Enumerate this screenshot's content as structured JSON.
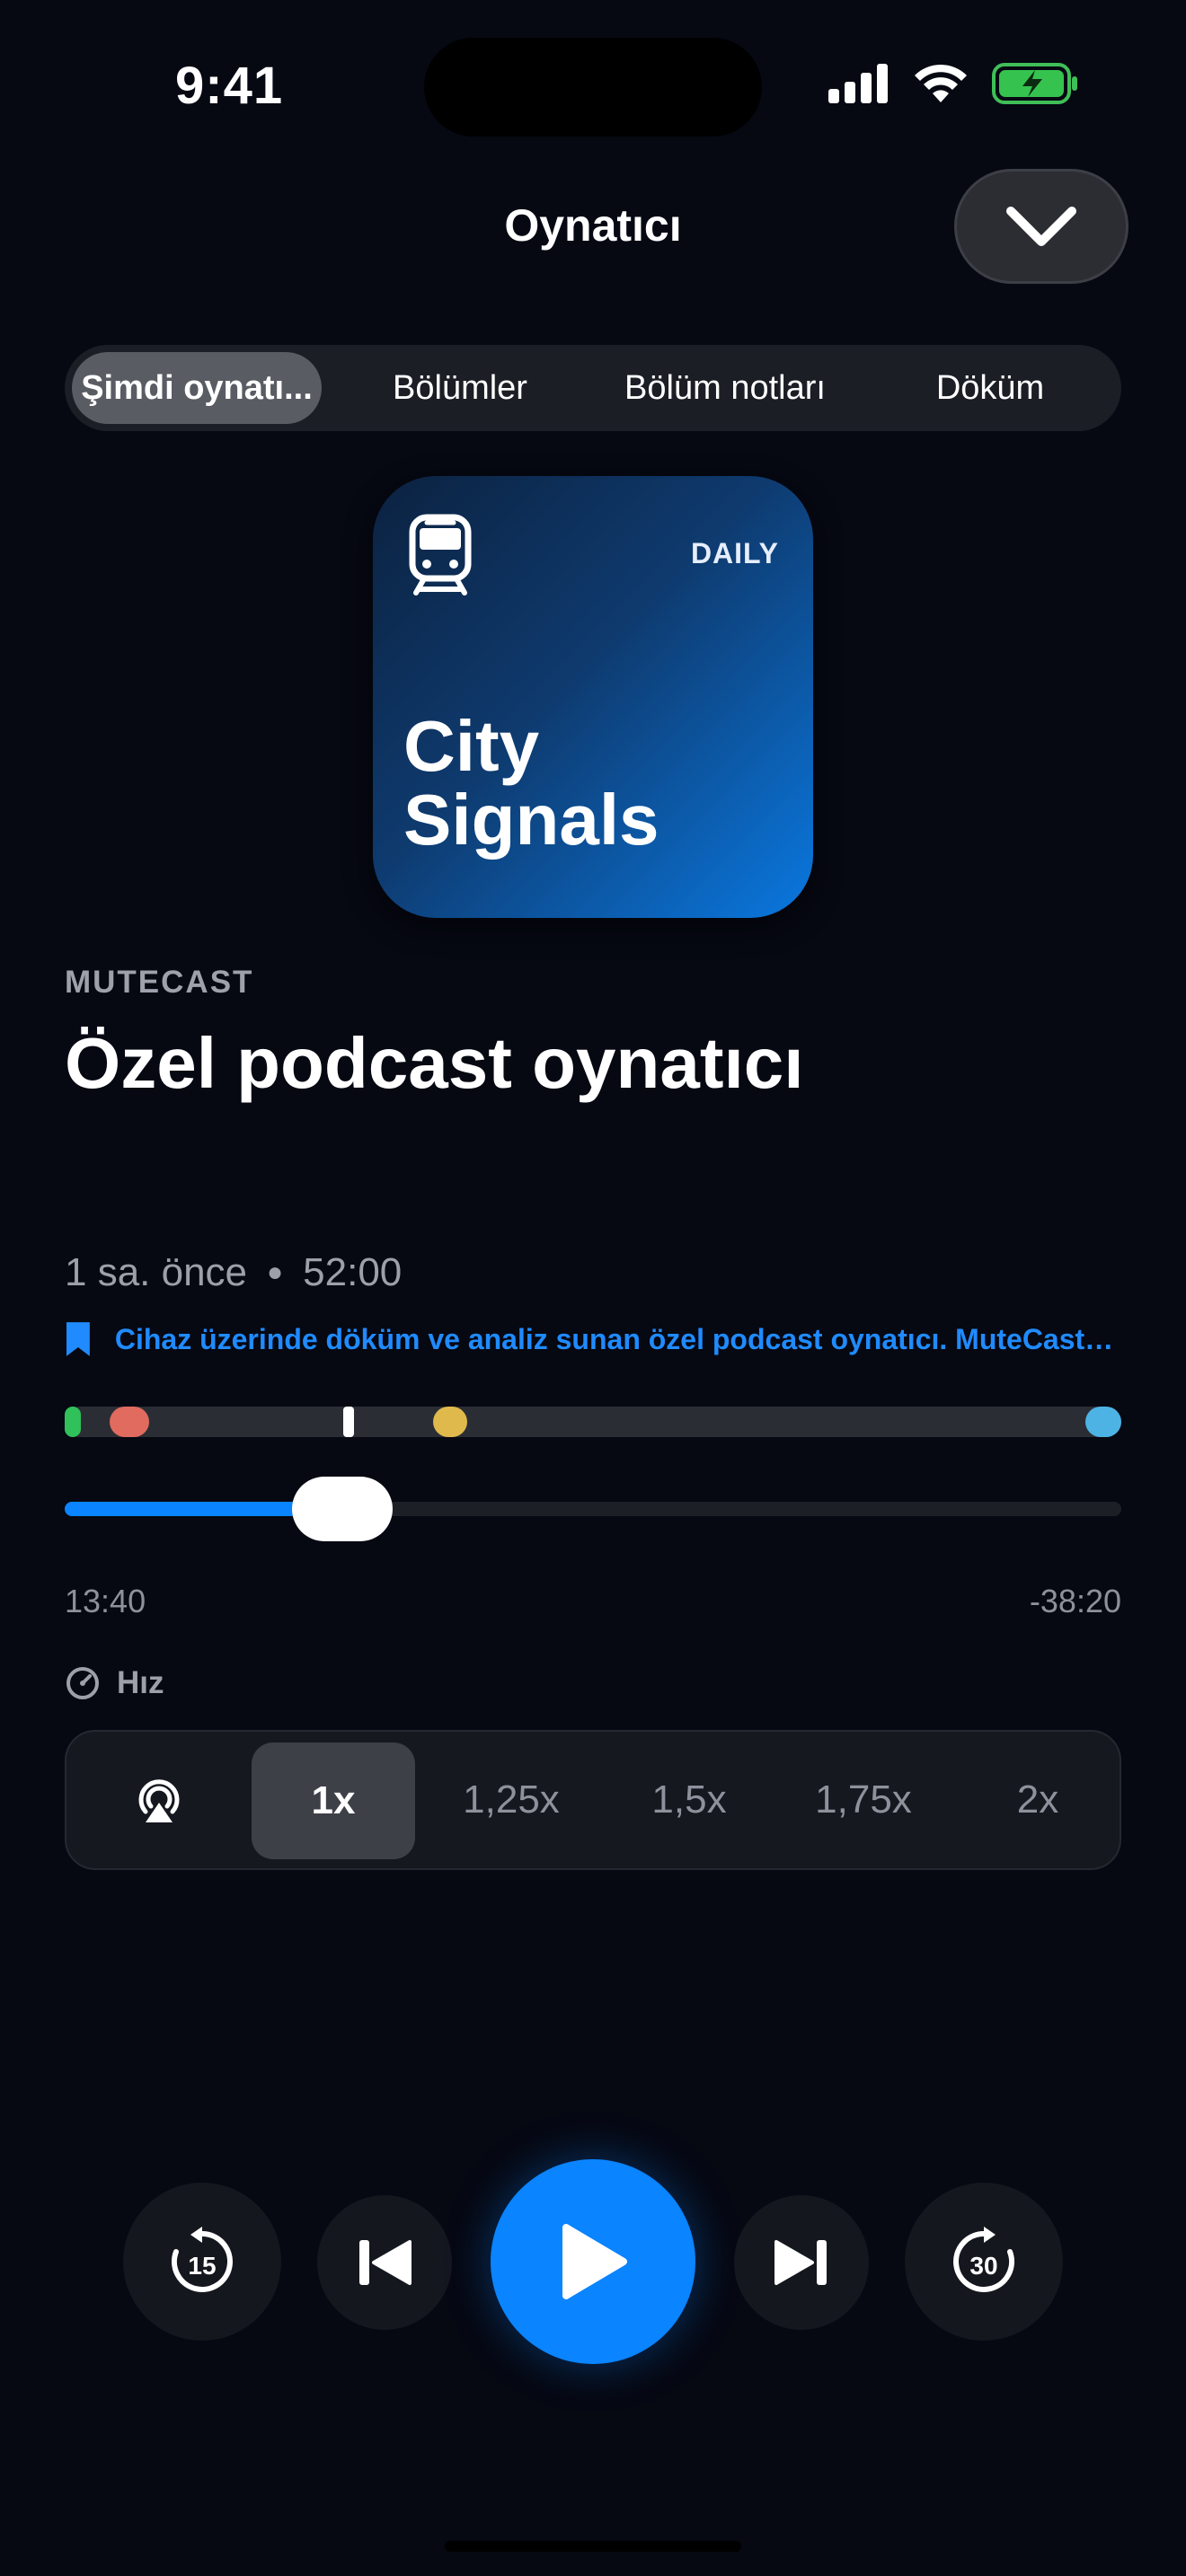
{
  "status_bar": {
    "time": "9:41"
  },
  "header": {
    "title": "Oynatıcı",
    "collapse_icon": "chevron-down-icon"
  },
  "tabs": [
    {
      "label": "Şimdi oynatı...",
      "selected": true
    },
    {
      "label": "Bölümler",
      "selected": false
    },
    {
      "label": "Bölüm notları",
      "selected": false
    },
    {
      "label": "Döküm",
      "selected": false
    }
  ],
  "artwork": {
    "badge": "DAILY",
    "line1": "City",
    "line2": "Signals",
    "icon": "train-icon"
  },
  "episode": {
    "publisher": "MUTECAST",
    "title": "Özel podcast oynatıcı",
    "published": "1 sa. önce",
    "duration": "52:00",
    "chapter": "Cihaz üzerinde döküm ve analiz sunan özel podcast oynatıcı. MuteCast hakkında"
  },
  "markers": [
    {
      "color": "#30c15a",
      "position": 0.004
    },
    {
      "color": "#e06b5e",
      "position": 0.06
    },
    {
      "color": "#ffffff",
      "position": 0.268
    },
    {
      "color": "#dfb94b",
      "position": 0.365
    },
    {
      "color": "#4db3e4",
      "position": 0.985
    }
  ],
  "progress": {
    "elapsed": "13:40",
    "remaining": "-38:20",
    "fraction": 0.263
  },
  "speed": {
    "label": "Hız",
    "airplay_icon": "airplay-icon",
    "options": [
      "1x",
      "1,25x",
      "1,5x",
      "1,75x",
      "2x"
    ],
    "selected": "1x"
  },
  "controls": {
    "skip_back": "15",
    "skip_forward": "30",
    "icons": [
      "rewind-15-icon",
      "previous-icon",
      "play-icon",
      "next-icon",
      "forward-30-icon"
    ]
  },
  "colors": {
    "accent": "#0a84ff",
    "background": "#060812"
  }
}
